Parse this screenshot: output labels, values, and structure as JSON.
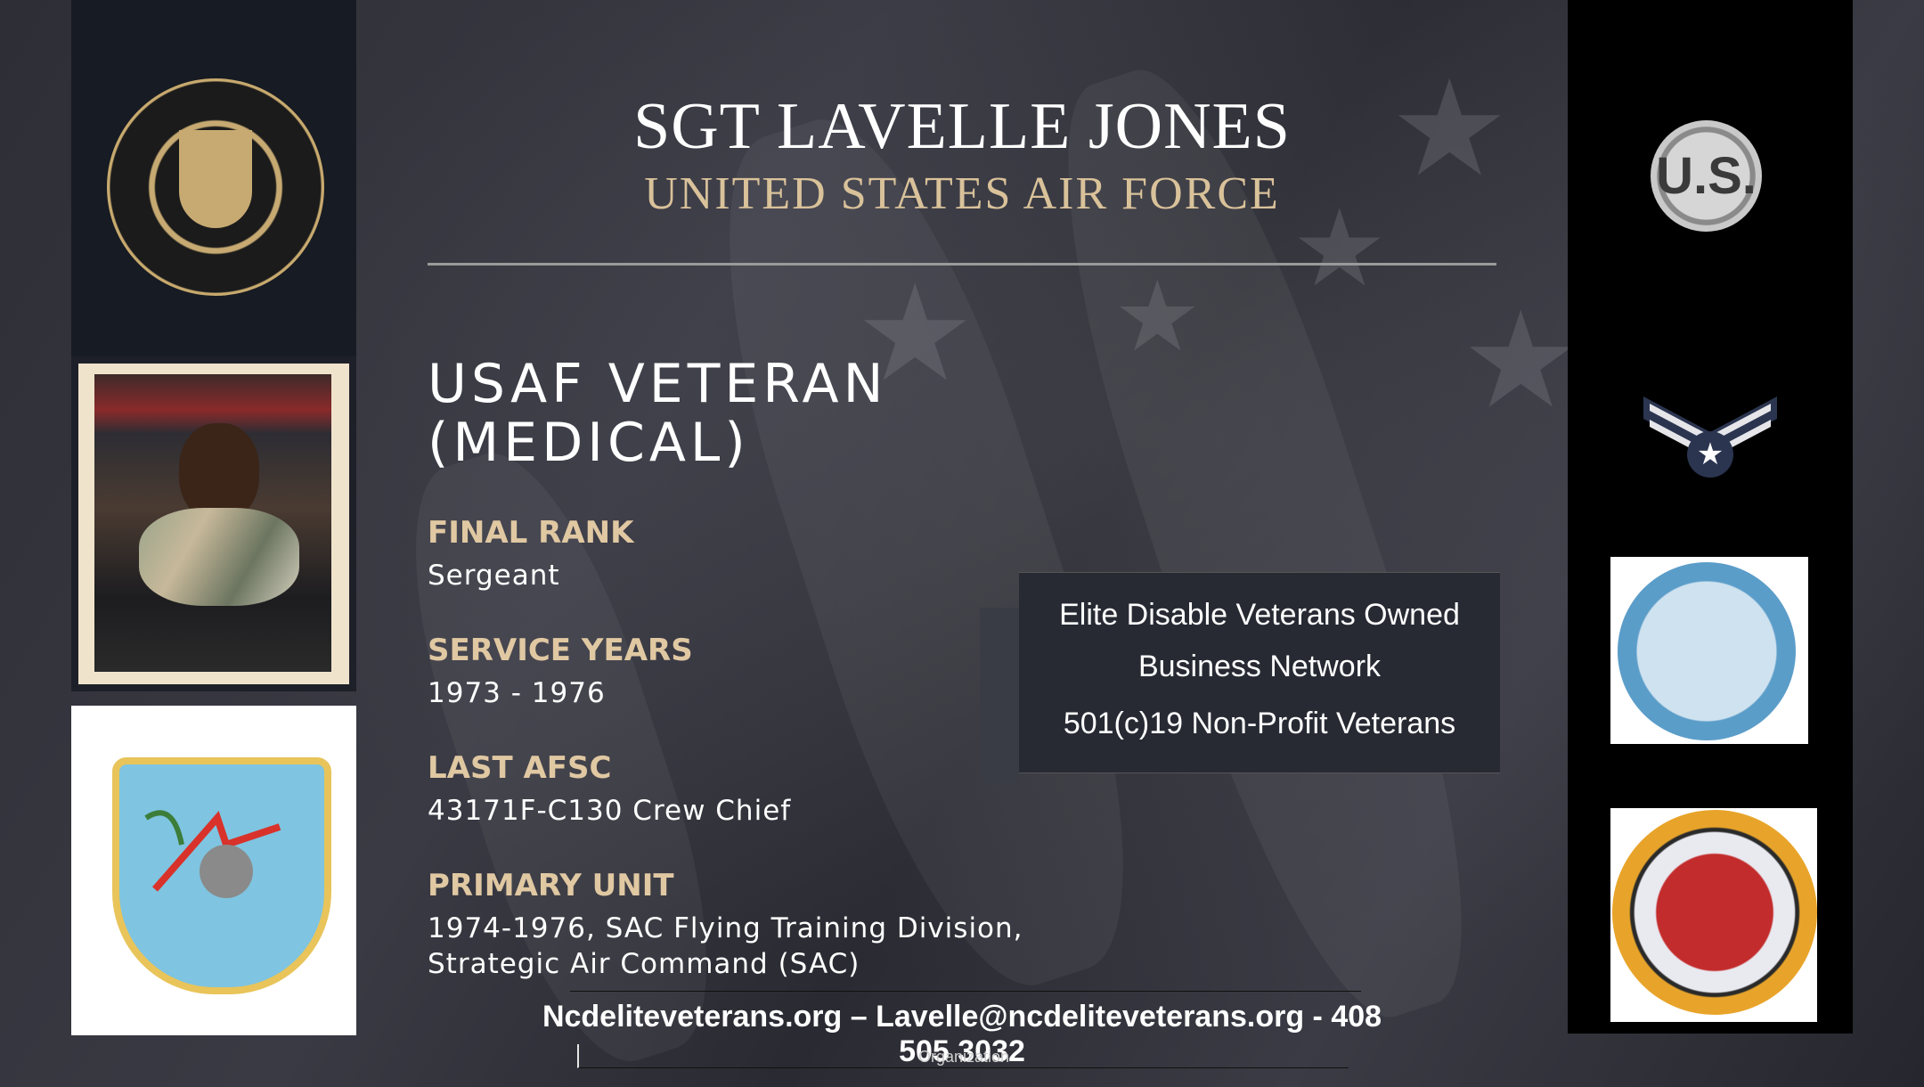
{
  "header": {
    "name": "SGT LAVELLE JONES",
    "branch": "UNITED STATES AIR FORCE"
  },
  "main": {
    "title": "USAF VETERAN (MEDICAL)",
    "sections": [
      {
        "label": "FINAL RANK",
        "value": "Sergeant"
      },
      {
        "label": "SERVICE YEARS",
        "value": "1973 - 1976"
      },
      {
        "label": "LAST AFSC",
        "value": "43171F-C130 Crew Chief"
      },
      {
        "label": "PRIMARY UNIT",
        "value": "1974-1976, SAC Flying Training Division,",
        "value2": "Strategic Air Command (SAC)"
      }
    ]
  },
  "organization": {
    "line1": "Elite Disable Veterans Owned Business Network",
    "line2": "501(c)19 Non-Profit Veterans"
  },
  "footer": {
    "contact": "Ncdeliteveterans.org – Lavelle@ncdeliteveterans.org - 408 505 3032",
    "caption": "Organization"
  },
  "badges": {
    "us_insignia": "U.S."
  },
  "colors": {
    "background": "#2b2b33",
    "accent_gold": "#d9c29a",
    "label_tan": "#e0c8a2",
    "side_panel": "#000000"
  }
}
